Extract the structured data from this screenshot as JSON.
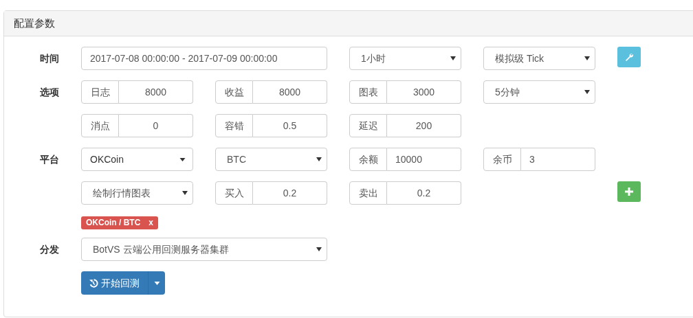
{
  "panel": {
    "title": "配置参数"
  },
  "rows": [
    {
      "label": "时间",
      "cells": [
        {
          "kind": "wide-text",
          "value": "2017-07-08 00:00:00 - 2017-07-09 00:00:00"
        },
        {
          "kind": "select",
          "value": "1小时"
        },
        {
          "kind": "select",
          "value": "模拟级 Tick"
        },
        {
          "kind": "settings-button"
        }
      ]
    },
    {
      "label": "选项",
      "cells": [
        {
          "kind": "addon",
          "addon": "日志",
          "value": "8000",
          "centered": true
        },
        {
          "kind": "addon",
          "addon": "收益",
          "value": "8000",
          "centered": true
        },
        {
          "kind": "addon",
          "addon": "图表",
          "value": "3000",
          "centered": true
        },
        {
          "kind": "select",
          "value": "5分钟"
        }
      ]
    },
    {
      "cells": [
        {
          "kind": "addon",
          "addon": "消点",
          "value": "0",
          "centered": true
        },
        {
          "kind": "addon",
          "addon": "容错",
          "value": "0.5",
          "centered": true
        },
        {
          "kind": "addon",
          "addon": "延迟",
          "value": "200",
          "centered": true
        }
      ]
    },
    {
      "label": "平台",
      "cells": [
        {
          "kind": "dropdown",
          "value": "OKCoin"
        },
        {
          "kind": "select",
          "value": "BTC"
        },
        {
          "kind": "addon",
          "addon": "余额",
          "value": "10000",
          "centered": false
        },
        {
          "kind": "addon",
          "addon": "余币",
          "value": "3",
          "centered": false
        }
      ]
    },
    {
      "cells": [
        {
          "kind": "select",
          "value": "绘制行情图表"
        },
        {
          "kind": "addon",
          "addon": "买入",
          "value": "0.2",
          "centered": true
        },
        {
          "kind": "addon",
          "addon": "卖出",
          "value": "0.2",
          "centered": true
        },
        {
          "kind": "spacer"
        },
        {
          "kind": "add-button"
        }
      ]
    }
  ],
  "tags": [
    {
      "text": "OKCoin / BTC",
      "remove": "x"
    }
  ],
  "distribution": {
    "label": "分发",
    "value": "BotVS 云端公用回测服务器集群"
  },
  "start_button": {
    "label": "开始回测"
  }
}
